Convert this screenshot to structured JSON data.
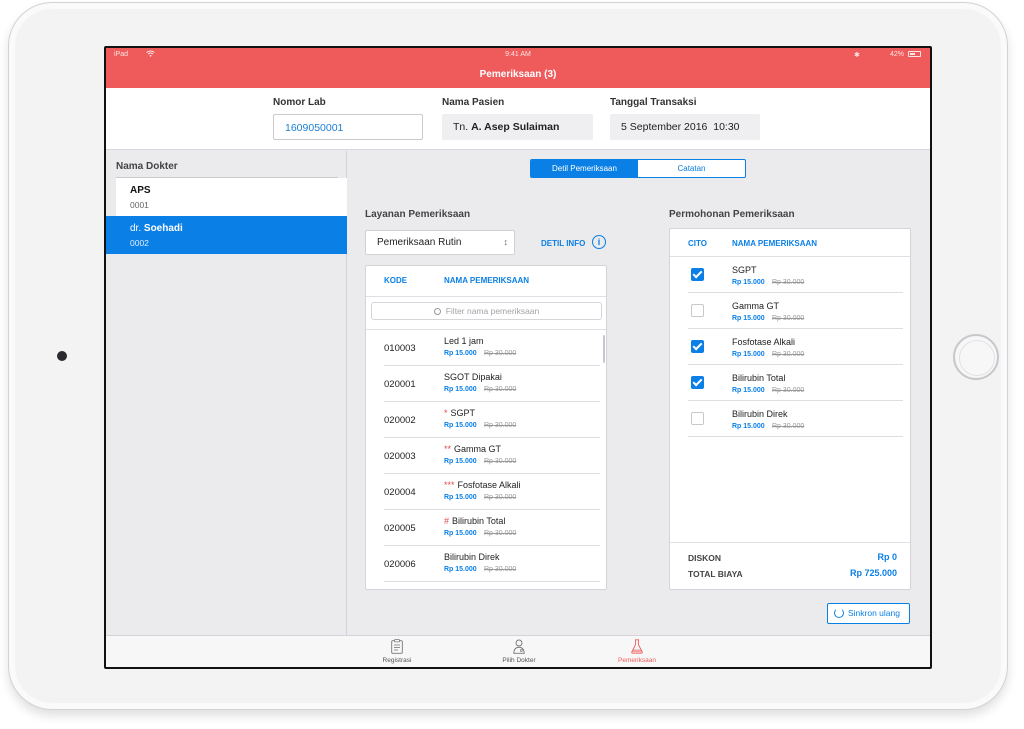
{
  "status_bar": {
    "device": "iPad",
    "time": "9:41 AM",
    "battery": "42%"
  },
  "nav": {
    "title": "Pemeriksaan (3)"
  },
  "header": {
    "nomor_lab": {
      "label": "Nomor Lab",
      "value": "1609050001"
    },
    "nama_pasien": {
      "label": "Nama Pasien",
      "prefix": "Tn.",
      "value": "A. Asep Sulaiman"
    },
    "tanggal_transaksi": {
      "label": "Tanggal Transaksi",
      "value": "5 September 2016  10:30"
    }
  },
  "sidebar": {
    "title": "Nama Dokter",
    "items": [
      {
        "name": "APS",
        "code": "0001",
        "selected": false
      },
      {
        "prefix": "dr.",
        "name": "Soehadi",
        "code": "0002",
        "selected": true
      }
    ]
  },
  "segmented": {
    "tabs": [
      "Detil Pemeriksaan",
      "Catatan"
    ],
    "active": 0
  },
  "layanan": {
    "title": "Layanan Pemeriksaan",
    "select_value": "Pemeriksaan Rutin",
    "detil_info": "DETIL INFO",
    "columns": {
      "kode": "KODE",
      "nama": "NAMA PEMERIKSAAN"
    },
    "filter_placeholder": "Filter nama pemeriksaan",
    "rows": [
      {
        "kode": "010003",
        "mark": "",
        "nama": "Led 1 jam",
        "price": "Rp 15.000",
        "old_price": "Rp 30.000"
      },
      {
        "kode": "020001",
        "mark": "",
        "nama": "SGOT Dipakai",
        "price": "Rp 15.000",
        "old_price": "Rp 30.000"
      },
      {
        "kode": "020002",
        "mark": "*",
        "nama": "SGPT",
        "price": "Rp 15.000",
        "old_price": "Rp 30.000"
      },
      {
        "kode": "020003",
        "mark": "**",
        "nama": "Gamma GT",
        "price": "Rp 15.000",
        "old_price": "Rp 30.000"
      },
      {
        "kode": "020004",
        "mark": "***",
        "nama": "Fosfotase Alkali",
        "price": "Rp 15.000",
        "old_price": "Rp 30.000"
      },
      {
        "kode": "020005",
        "mark": "#",
        "nama": "Bilirubin Total",
        "price": "Rp 15.000",
        "old_price": "Rp 30.000"
      },
      {
        "kode": "020006",
        "mark": "",
        "nama": "Bilirubin Direk",
        "price": "Rp 15.000",
        "old_price": "Rp 30.000"
      }
    ]
  },
  "permohonan": {
    "title": "Permohonan Pemeriksaan",
    "columns": {
      "cito": "CITO",
      "nama": "NAMA PEMERIKSAAN"
    },
    "rows": [
      {
        "checked": true,
        "nama": "SGPT",
        "price": "Rp 15.000",
        "old_price": "Rp 30.000"
      },
      {
        "checked": false,
        "nama": "Gamma GT",
        "price": "Rp 15.000",
        "old_price": "Rp 30.000"
      },
      {
        "checked": true,
        "nama": "Fosfotase Alkali",
        "price": "Rp 15.000",
        "old_price": "Rp 30.000"
      },
      {
        "checked": true,
        "nama": "Bilirubin Total",
        "price": "Rp 15.000",
        "old_price": "Rp 30.000"
      },
      {
        "checked": false,
        "nama": "Bilirubin Direk",
        "price": "Rp 15.000",
        "old_price": "Rp 30.000"
      }
    ],
    "diskon": {
      "label": "DISKON",
      "value": "Rp 0"
    },
    "total": {
      "label": "TOTAL BIAYA",
      "value": "Rp 725.000"
    }
  },
  "sync_button": "Sinkron ulang",
  "tabbar": [
    {
      "label": "Registrasi",
      "icon": "clipboard-icon",
      "active": false
    },
    {
      "label": "Pilih Dokter",
      "icon": "doctor-icon",
      "active": false
    },
    {
      "label": "Pemeriksaan",
      "icon": "flask-icon",
      "active": true
    }
  ],
  "colors": {
    "nav_red": "#ef5b5b",
    "accent_blue": "#0a7fe6"
  }
}
